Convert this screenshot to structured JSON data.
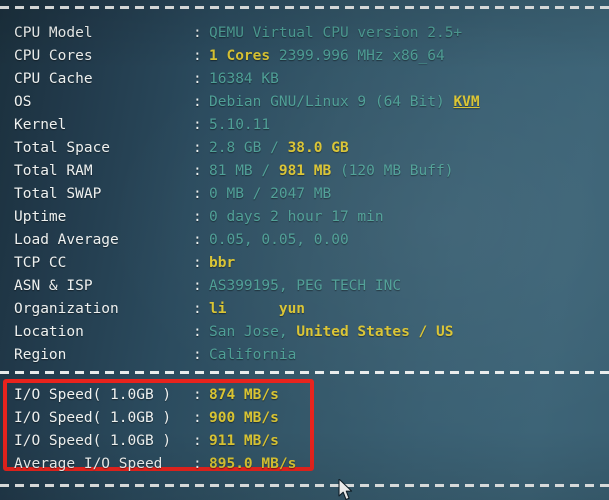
{
  "terminal": {
    "title": "bench.sh system information output",
    "colors": {
      "background_dark": "#1b303d",
      "background_light": "#3d6477",
      "label": "#eef1f0",
      "value": "#4e9f96",
      "highlight": "#d9c433",
      "annotation_box": "#e8231d",
      "rule": "#f2f4f3"
    },
    "separator": "----------------------------------------------------------------------",
    "separator_char": "-",
    "colon": ":",
    "info_rows": [
      {
        "label": "CPU Model",
        "segments": [
          {
            "text": "QEMU Virtual CPU version 2.5+",
            "style": "value"
          }
        ]
      },
      {
        "label": "CPU Cores",
        "segments": [
          {
            "text": "1 Cores",
            "style": "highlight"
          },
          {
            "text": " 2399.996 MHz x86_64",
            "style": "value"
          }
        ]
      },
      {
        "label": "CPU Cache",
        "segments": [
          {
            "text": "16384 KB",
            "style": "value"
          }
        ]
      },
      {
        "label": "OS",
        "segments": [
          {
            "text": "Debian GNU/Linux 9 (64 Bit) ",
            "style": "value"
          },
          {
            "text": "KVM",
            "style": "highlight-underline"
          }
        ]
      },
      {
        "label": "Kernel",
        "segments": [
          {
            "text": "5.10.11",
            "style": "value"
          }
        ]
      },
      {
        "label": "Total Space",
        "segments": [
          {
            "text": "2.8 GB / ",
            "style": "value"
          },
          {
            "text": "38.0 GB",
            "style": "highlight"
          }
        ]
      },
      {
        "label": "Total RAM",
        "segments": [
          {
            "text": "81 MB / ",
            "style": "value"
          },
          {
            "text": "981 MB",
            "style": "highlight"
          },
          {
            "text": " (120 MB Buff)",
            "style": "value"
          }
        ]
      },
      {
        "label": "Total SWAP",
        "segments": [
          {
            "text": "0 MB / 2047 MB",
            "style": "value"
          }
        ]
      },
      {
        "label": "Uptime",
        "segments": [
          {
            "text": "0 days 2 hour 17 min",
            "style": "value"
          }
        ]
      },
      {
        "label": "Load Average",
        "segments": [
          {
            "text": "0.05, 0.05, 0.00",
            "style": "value"
          }
        ]
      },
      {
        "label": "TCP CC",
        "segments": [
          {
            "text": "bbr",
            "style": "highlight"
          }
        ]
      },
      {
        "label": "ASN & ISP",
        "segments": [
          {
            "text": "AS399195, PEG TECH INC",
            "style": "value"
          }
        ]
      },
      {
        "label": "Organization",
        "segments": [
          {
            "text": "li      yun",
            "style": "highlight"
          }
        ]
      },
      {
        "label": "Location",
        "segments": [
          {
            "text": "San Jose, ",
            "style": "value"
          },
          {
            "text": "United States / US",
            "style": "highlight"
          }
        ]
      },
      {
        "label": "Region",
        "segments": [
          {
            "text": "California",
            "style": "value"
          }
        ]
      }
    ],
    "io_rows": [
      {
        "label": "I/O Speed( 1.0GB )",
        "segments": [
          {
            "text": "874 MB/s",
            "style": "highlight"
          }
        ]
      },
      {
        "label": "I/O Speed( 1.0GB )",
        "segments": [
          {
            "text": "900 MB/s",
            "style": "highlight"
          }
        ]
      },
      {
        "label": "I/O Speed( 1.0GB )",
        "segments": [
          {
            "text": "911 MB/s",
            "style": "highlight"
          }
        ]
      },
      {
        "label": "Average I/O Speed",
        "segments": [
          {
            "text": "895.0 MB/s",
            "style": "highlight"
          }
        ]
      }
    ]
  }
}
